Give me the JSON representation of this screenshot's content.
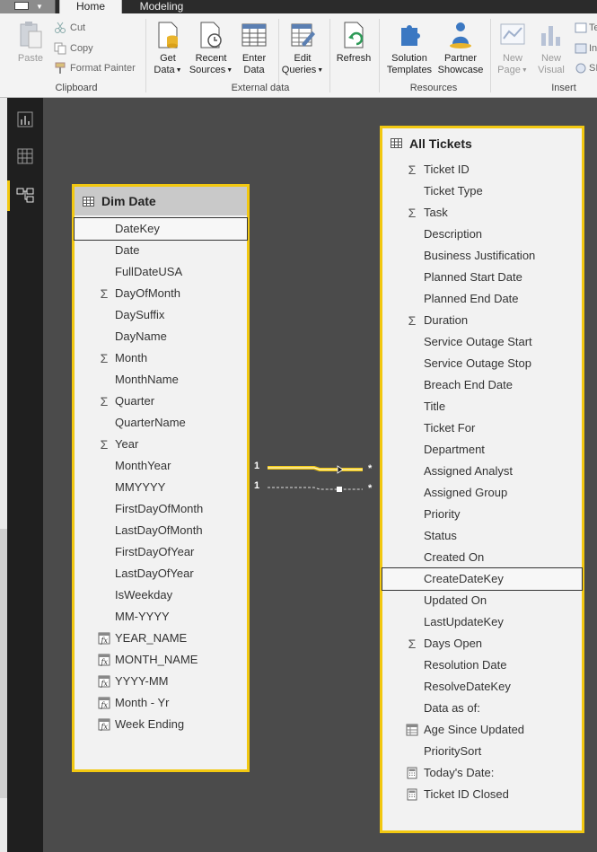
{
  "tabs": {
    "home": "Home",
    "modeling": "Modeling"
  },
  "ribbon": {
    "clipboard": {
      "label": "Clipboard",
      "paste": "Paste",
      "cut": "Cut",
      "copy": "Copy",
      "format_painter": "Format Painter"
    },
    "external": {
      "label": "External data",
      "get_data": [
        "Get",
        "Data"
      ],
      "recent_sources": [
        "Recent",
        "Sources"
      ],
      "enter_data": [
        "Enter",
        "Data"
      ],
      "edit_queries": [
        "Edit",
        "Queries"
      ],
      "refresh": "Refresh"
    },
    "resources": {
      "label": "Resources",
      "solution_templates": [
        "Solution",
        "Templates"
      ],
      "partner_showcase": [
        "Partner",
        "Showcase"
      ]
    },
    "insert": {
      "label": "Insert",
      "new_page": [
        "New",
        "Page"
      ],
      "new_visual": [
        "New",
        "Visual"
      ],
      "right_items": [
        "Te",
        "In",
        "SI"
      ]
    }
  },
  "accent_color": "#f2c811",
  "dim_date": {
    "title": "Dim Date",
    "fields": [
      {
        "name": "DateKey",
        "icon": "none",
        "selected": true
      },
      {
        "name": "Date",
        "icon": "none"
      },
      {
        "name": "FullDateUSA",
        "icon": "none"
      },
      {
        "name": "DayOfMonth",
        "icon": "sigma"
      },
      {
        "name": "DaySuffix",
        "icon": "none"
      },
      {
        "name": "DayName",
        "icon": "none"
      },
      {
        "name": "Month",
        "icon": "sigma"
      },
      {
        "name": "MonthName",
        "icon": "none"
      },
      {
        "name": "Quarter",
        "icon": "sigma"
      },
      {
        "name": "QuarterName",
        "icon": "none"
      },
      {
        "name": "Year",
        "icon": "sigma"
      },
      {
        "name": "MonthYear",
        "icon": "none"
      },
      {
        "name": "MMYYYY",
        "icon": "none"
      },
      {
        "name": "FirstDayOfMonth",
        "icon": "none"
      },
      {
        "name": "LastDayOfMonth",
        "icon": "none"
      },
      {
        "name": "FirstDayOfYear",
        "icon": "none"
      },
      {
        "name": "LastDayOfYear",
        "icon": "none"
      },
      {
        "name": "IsWeekday",
        "icon": "none"
      },
      {
        "name": "MM-YYYY",
        "icon": "none"
      },
      {
        "name": "YEAR_NAME",
        "icon": "calc-column"
      },
      {
        "name": "MONTH_NAME",
        "icon": "calc-column"
      },
      {
        "name": "YYYY-MM",
        "icon": "calc-column"
      },
      {
        "name": "Month - Yr",
        "icon": "calc-column"
      },
      {
        "name": "Week Ending",
        "icon": "calc-column"
      }
    ]
  },
  "all_tickets": {
    "title": "All Tickets",
    "fields": [
      {
        "name": "Ticket ID",
        "icon": "sigma"
      },
      {
        "name": "Ticket Type",
        "icon": "none"
      },
      {
        "name": "Task",
        "icon": "sigma"
      },
      {
        "name": "Description",
        "icon": "none"
      },
      {
        "name": "Business Justification",
        "icon": "none"
      },
      {
        "name": "Planned Start Date",
        "icon": "none"
      },
      {
        "name": "Planned End Date",
        "icon": "none"
      },
      {
        "name": "Duration",
        "icon": "sigma"
      },
      {
        "name": "Service Outage Start",
        "icon": "none"
      },
      {
        "name": "Service Outage Stop",
        "icon": "none"
      },
      {
        "name": "Breach End Date",
        "icon": "none"
      },
      {
        "name": "Title",
        "icon": "none"
      },
      {
        "name": "Ticket For",
        "icon": "none"
      },
      {
        "name": "Department",
        "icon": "none"
      },
      {
        "name": "Assigned Analyst",
        "icon": "none"
      },
      {
        "name": "Assigned Group",
        "icon": "none"
      },
      {
        "name": "Priority",
        "icon": "none"
      },
      {
        "name": "Status",
        "icon": "none"
      },
      {
        "name": "Created On",
        "icon": "none"
      },
      {
        "name": "CreateDateKey",
        "icon": "none",
        "selected": true
      },
      {
        "name": "Updated On",
        "icon": "none"
      },
      {
        "name": "LastUpdateKey",
        "icon": "none"
      },
      {
        "name": "Days Open",
        "icon": "sigma"
      },
      {
        "name": "Resolution Date",
        "icon": "none"
      },
      {
        "name": "ResolveDateKey",
        "icon": "none"
      },
      {
        "name": "Data as of:",
        "icon": "none"
      },
      {
        "name": "Age Since Updated",
        "icon": "calc-table"
      },
      {
        "name": "PrioritySort",
        "icon": "none"
      },
      {
        "name": "Today's Date:",
        "icon": "calculator"
      },
      {
        "name": "Ticket ID Closed",
        "icon": "calculator"
      }
    ]
  },
  "relationships": [
    {
      "from_card": "1",
      "to_card": "*",
      "active": true
    },
    {
      "from_card": "1",
      "to_card": "*",
      "active": false
    }
  ]
}
